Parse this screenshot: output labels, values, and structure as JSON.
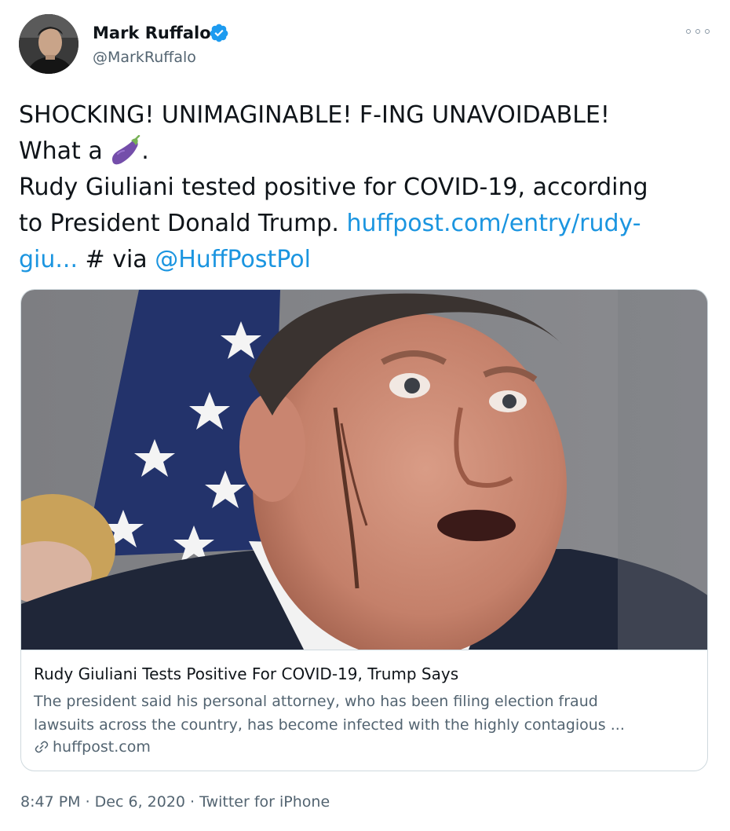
{
  "author": {
    "name": "Mark Ruffalo",
    "handle": "@MarkRuffalo",
    "verified": true
  },
  "tweet": {
    "line1": "SHOCKING!  UNIMAGINABLE! F-ING UNAVOIDABLE!",
    "line2_prefix": "What a",
    "line2_suffix": ".",
    "line3": "Rudy Giuliani tested positive for COVID-19, according",
    "line4_text": "to President Donald Trump.",
    "line4_link": "huffpost.com/entry/rudy-",
    "line5_link": "giu...",
    "line5_mid": "# via",
    "line5_mention": "@HuffPostPol",
    "emoji": "eggplant-emoji"
  },
  "card": {
    "title": "Rudy Giuliani Tests Positive For COVID-19, Trump Says",
    "description_line1": "The president said his personal attorney, who has been filing election fraud",
    "description_line2": "lawsuits across the country, has become infected with the highly contagious ...",
    "domain": "huffpost.com",
    "image": "press-photo-rudy-giuliani-flag-background"
  },
  "footer": {
    "timestamp": "8:47 PM · Dec 6, 2020 · Twitter for iPhone"
  },
  "colors": {
    "link": "#1b95e0",
    "secondary": "#536471",
    "verified": "#1d9bf0",
    "border": "#cfd9de"
  }
}
